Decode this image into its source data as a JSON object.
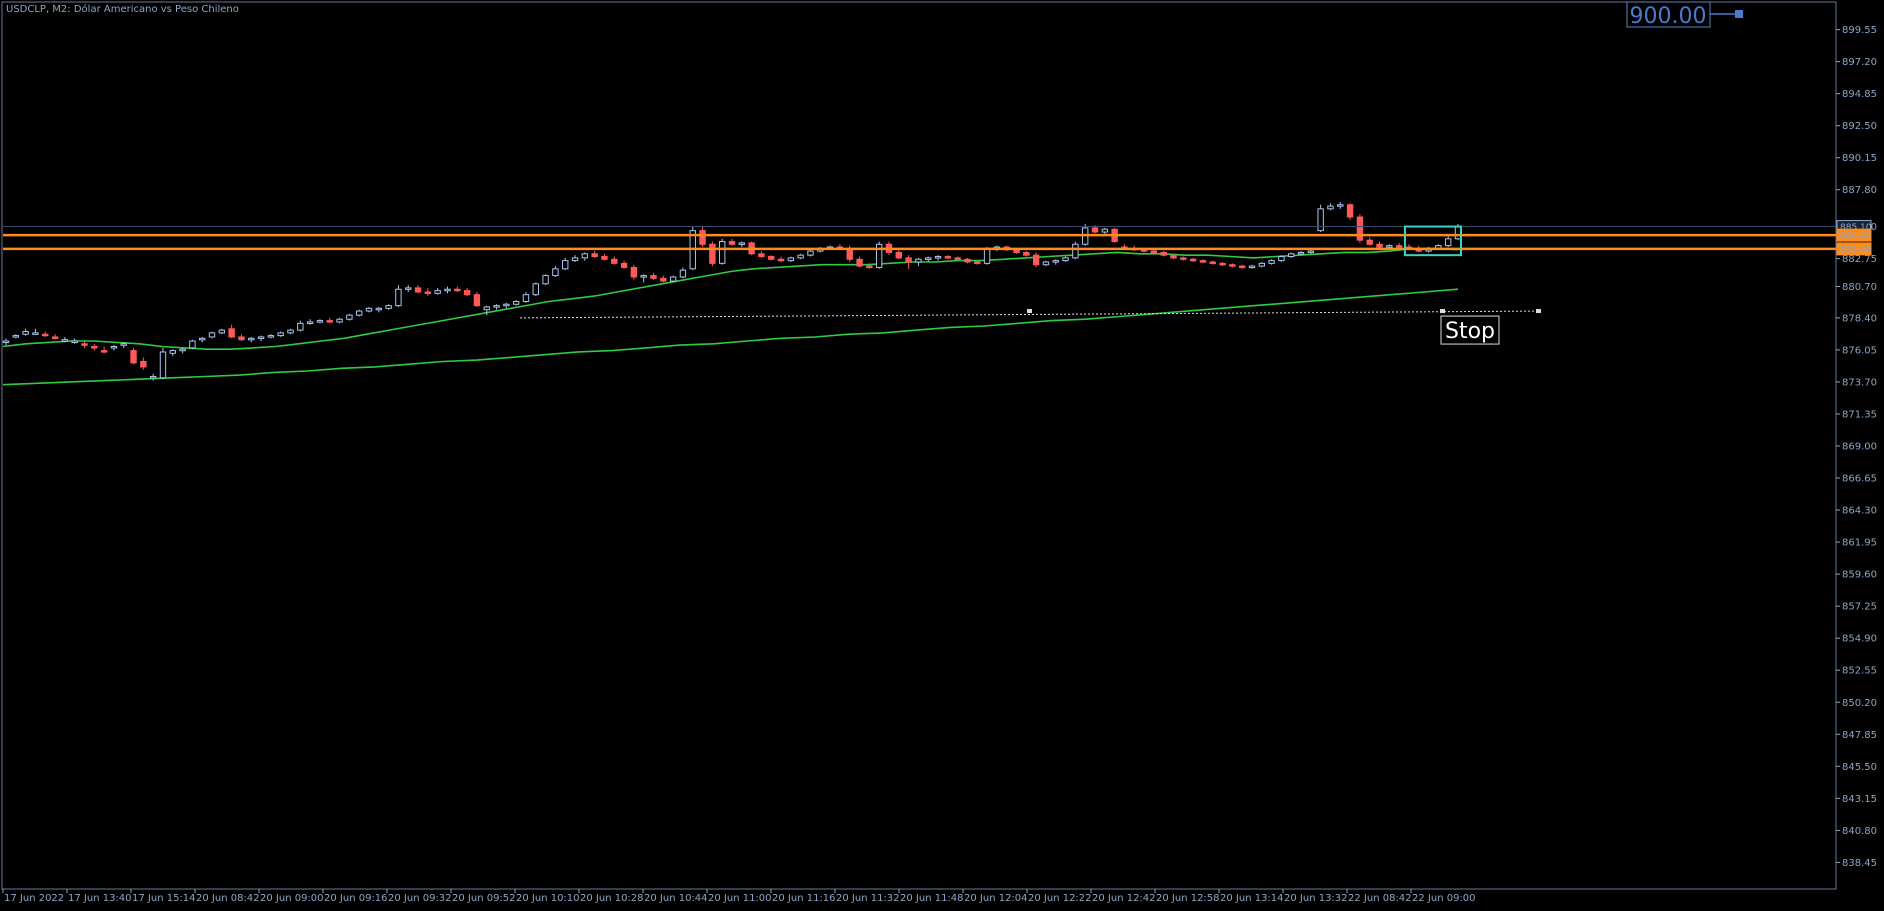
{
  "chart_data": {
    "type": "candlestick",
    "title": "USDCLP, M2:  Dólar Americano vs Peso Chileno",
    "symbol": "USDCLP",
    "timeframe": "M2",
    "description": "Dólar Americano vs Peso Chileno",
    "ylim": [
      836.5,
      901.5
    ],
    "y_ticks": [
      "899.55",
      "897.20",
      "894.85",
      "892.50",
      "890.15",
      "887.80",
      "885.10",
      "882.75",
      "880.70",
      "878.40",
      "876.05",
      "873.70",
      "871.35",
      "869.00",
      "866.65",
      "864.30",
      "861.95",
      "859.60",
      "857.25",
      "854.90",
      "852.55",
      "850.20",
      "847.85",
      "845.50",
      "843.15",
      "840.80",
      "838.45"
    ],
    "x_ticks": [
      "17 Jun 2022",
      "17 Jun 13:40",
      "17 Jun 15:14",
      "20 Jun 08:42",
      "20 Jun 09:00",
      "20 Jun 09:16",
      "20 Jun 09:32",
      "20 Jun 09:52",
      "20 Jun 10:10",
      "20 Jun 10:28",
      "20 Jun 10:44",
      "20 Jun 11:00",
      "20 Jun 11:16",
      "20 Jun 11:32",
      "20 Jun 11:48",
      "20 Jun 12:04",
      "20 Jun 12:22",
      "20 Jun 12:42",
      "20 Jun 12:58",
      "20 Jun 13:14",
      "20 Jun 13:32",
      "22 Jun 08:42",
      "22 Jun 09:00"
    ],
    "candles": [
      {
        "o": 876.6,
        "h": 876.9,
        "l": 876.4,
        "c": 876.7
      },
      {
        "o": 877.0,
        "h": 877.2,
        "l": 876.9,
        "c": 877.1
      },
      {
        "o": 877.2,
        "h": 877.6,
        "l": 877.1,
        "c": 877.4
      },
      {
        "o": 877.3,
        "h": 877.6,
        "l": 877.2,
        "c": 877.3
      },
      {
        "o": 877.2,
        "h": 877.4,
        "l": 877.0,
        "c": 877.1
      },
      {
        "o": 877.0,
        "h": 877.2,
        "l": 876.8,
        "c": 876.9
      },
      {
        "o": 876.8,
        "h": 877.0,
        "l": 876.6,
        "c": 876.8
      },
      {
        "o": 876.7,
        "h": 876.9,
        "l": 876.5,
        "c": 876.7
      },
      {
        "o": 876.5,
        "h": 876.7,
        "l": 876.2,
        "c": 876.4
      },
      {
        "o": 876.3,
        "h": 876.5,
        "l": 876.0,
        "c": 876.2
      },
      {
        "o": 876.0,
        "h": 876.3,
        "l": 875.8,
        "c": 875.9
      },
      {
        "o": 876.2,
        "h": 876.4,
        "l": 876.0,
        "c": 876.3
      },
      {
        "o": 876.4,
        "h": 876.6,
        "l": 876.2,
        "c": 876.5
      },
      {
        "o": 876.0,
        "h": 876.2,
        "l": 875.0,
        "c": 875.1
      },
      {
        "o": 875.2,
        "h": 875.5,
        "l": 874.6,
        "c": 874.8
      },
      {
        "o": 874.0,
        "h": 874.3,
        "l": 873.8,
        "c": 874.1
      },
      {
        "o": 874.0,
        "h": 876.2,
        "l": 873.9,
        "c": 875.9
      },
      {
        "o": 875.8,
        "h": 876.1,
        "l": 875.6,
        "c": 876.0
      },
      {
        "o": 876.0,
        "h": 876.2,
        "l": 875.8,
        "c": 876.1
      },
      {
        "o": 876.2,
        "h": 876.8,
        "l": 876.1,
        "c": 876.7
      },
      {
        "o": 876.8,
        "h": 877.0,
        "l": 876.6,
        "c": 876.9
      },
      {
        "o": 877.0,
        "h": 877.4,
        "l": 876.9,
        "c": 877.3
      },
      {
        "o": 877.3,
        "h": 877.6,
        "l": 877.2,
        "c": 877.5
      },
      {
        "o": 877.6,
        "h": 877.9,
        "l": 876.9,
        "c": 877.0
      },
      {
        "o": 877.0,
        "h": 877.2,
        "l": 876.7,
        "c": 876.8
      },
      {
        "o": 876.8,
        "h": 877.0,
        "l": 876.6,
        "c": 876.9
      },
      {
        "o": 876.9,
        "h": 877.1,
        "l": 876.7,
        "c": 877.0
      },
      {
        "o": 877.0,
        "h": 877.2,
        "l": 876.9,
        "c": 877.1
      },
      {
        "o": 877.1,
        "h": 877.4,
        "l": 877.0,
        "c": 877.3
      },
      {
        "o": 877.3,
        "h": 877.6,
        "l": 877.2,
        "c": 877.5
      },
      {
        "o": 877.5,
        "h": 878.2,
        "l": 877.4,
        "c": 878.0
      },
      {
        "o": 878.0,
        "h": 878.3,
        "l": 877.9,
        "c": 878.1
      },
      {
        "o": 878.1,
        "h": 878.3,
        "l": 878.0,
        "c": 878.2
      },
      {
        "o": 878.2,
        "h": 878.4,
        "l": 878.0,
        "c": 878.1
      },
      {
        "o": 878.1,
        "h": 878.4,
        "l": 878.0,
        "c": 878.3
      },
      {
        "o": 878.3,
        "h": 878.7,
        "l": 878.2,
        "c": 878.6
      },
      {
        "o": 878.6,
        "h": 879.0,
        "l": 878.5,
        "c": 878.9
      },
      {
        "o": 878.9,
        "h": 879.2,
        "l": 878.8,
        "c": 879.1
      },
      {
        "o": 879.0,
        "h": 879.2,
        "l": 878.8,
        "c": 879.1
      },
      {
        "o": 879.1,
        "h": 879.4,
        "l": 879.0,
        "c": 879.3
      },
      {
        "o": 879.3,
        "h": 880.8,
        "l": 879.2,
        "c": 880.5
      },
      {
        "o": 880.5,
        "h": 880.8,
        "l": 880.3,
        "c": 880.6
      },
      {
        "o": 880.6,
        "h": 880.8,
        "l": 880.2,
        "c": 880.3
      },
      {
        "o": 880.3,
        "h": 880.6,
        "l": 880.0,
        "c": 880.2
      },
      {
        "o": 880.2,
        "h": 880.6,
        "l": 880.1,
        "c": 880.4
      },
      {
        "o": 880.4,
        "h": 880.7,
        "l": 880.2,
        "c": 880.5
      },
      {
        "o": 880.5,
        "h": 880.7,
        "l": 880.3,
        "c": 880.4
      },
      {
        "o": 880.4,
        "h": 880.6,
        "l": 880.0,
        "c": 880.1
      },
      {
        "o": 880.1,
        "h": 880.3,
        "l": 879.2,
        "c": 879.3
      },
      {
        "o": 879.0,
        "h": 879.3,
        "l": 878.6,
        "c": 879.2
      },
      {
        "o": 879.2,
        "h": 879.4,
        "l": 879.0,
        "c": 879.3
      },
      {
        "o": 879.3,
        "h": 879.5,
        "l": 879.1,
        "c": 879.4
      },
      {
        "o": 879.4,
        "h": 879.7,
        "l": 879.3,
        "c": 879.6
      },
      {
        "o": 879.6,
        "h": 880.3,
        "l": 879.5,
        "c": 880.1
      },
      {
        "o": 880.1,
        "h": 881.0,
        "l": 880.0,
        "c": 880.9
      },
      {
        "o": 880.9,
        "h": 881.6,
        "l": 880.8,
        "c": 881.5
      },
      {
        "o": 881.5,
        "h": 882.2,
        "l": 881.4,
        "c": 882.0
      },
      {
        "o": 882.0,
        "h": 882.8,
        "l": 881.9,
        "c": 882.6
      },
      {
        "o": 882.6,
        "h": 883.0,
        "l": 882.5,
        "c": 882.8
      },
      {
        "o": 882.8,
        "h": 883.2,
        "l": 882.6,
        "c": 883.1
      },
      {
        "o": 883.1,
        "h": 883.3,
        "l": 882.8,
        "c": 882.9
      },
      {
        "o": 882.9,
        "h": 883.1,
        "l": 882.6,
        "c": 882.7
      },
      {
        "o": 882.7,
        "h": 882.9,
        "l": 882.3,
        "c": 882.4
      },
      {
        "o": 882.4,
        "h": 882.6,
        "l": 882.0,
        "c": 882.1
      },
      {
        "o": 882.1,
        "h": 882.3,
        "l": 881.2,
        "c": 881.4
      },
      {
        "o": 881.4,
        "h": 881.6,
        "l": 881.0,
        "c": 881.5
      },
      {
        "o": 881.5,
        "h": 881.7,
        "l": 881.2,
        "c": 881.3
      },
      {
        "o": 881.3,
        "h": 881.5,
        "l": 881.0,
        "c": 881.1
      },
      {
        "o": 881.1,
        "h": 881.5,
        "l": 881.0,
        "c": 881.4
      },
      {
        "o": 881.4,
        "h": 882.1,
        "l": 881.3,
        "c": 881.9
      },
      {
        "o": 882.0,
        "h": 885.1,
        "l": 881.9,
        "c": 884.8
      },
      {
        "o": 884.8,
        "h": 885.1,
        "l": 883.6,
        "c": 883.8
      },
      {
        "o": 883.8,
        "h": 884.0,
        "l": 882.2,
        "c": 882.4
      },
      {
        "o": 882.4,
        "h": 884.2,
        "l": 882.3,
        "c": 884.0
      },
      {
        "o": 884.0,
        "h": 884.2,
        "l": 883.7,
        "c": 883.8
      },
      {
        "o": 883.8,
        "h": 884.0,
        "l": 883.6,
        "c": 883.9
      },
      {
        "o": 883.9,
        "h": 884.0,
        "l": 883.0,
        "c": 883.1
      },
      {
        "o": 883.1,
        "h": 883.3,
        "l": 882.8,
        "c": 882.9
      },
      {
        "o": 882.9,
        "h": 883.0,
        "l": 882.6,
        "c": 882.7
      },
      {
        "o": 882.7,
        "h": 882.9,
        "l": 882.5,
        "c": 882.6
      },
      {
        "o": 882.6,
        "h": 882.9,
        "l": 882.5,
        "c": 882.8
      },
      {
        "o": 882.8,
        "h": 883.1,
        "l": 882.7,
        "c": 883.0
      },
      {
        "o": 883.0,
        "h": 883.4,
        "l": 882.9,
        "c": 883.3
      },
      {
        "o": 883.3,
        "h": 883.6,
        "l": 883.2,
        "c": 883.5
      },
      {
        "o": 883.5,
        "h": 883.7,
        "l": 883.4,
        "c": 883.6
      },
      {
        "o": 883.6,
        "h": 883.8,
        "l": 883.4,
        "c": 883.5
      },
      {
        "o": 883.5,
        "h": 883.7,
        "l": 882.5,
        "c": 882.7
      },
      {
        "o": 882.7,
        "h": 882.9,
        "l": 882.1,
        "c": 882.2
      },
      {
        "o": 882.2,
        "h": 882.4,
        "l": 882.0,
        "c": 882.1
      },
      {
        "o": 882.1,
        "h": 884.0,
        "l": 882.0,
        "c": 883.8
      },
      {
        "o": 883.8,
        "h": 884.0,
        "l": 883.0,
        "c": 883.2
      },
      {
        "o": 883.2,
        "h": 883.4,
        "l": 882.7,
        "c": 882.8
      },
      {
        "o": 882.8,
        "h": 883.0,
        "l": 882.0,
        "c": 882.5
      },
      {
        "o": 882.5,
        "h": 882.8,
        "l": 882.2,
        "c": 882.7
      },
      {
        "o": 882.7,
        "h": 882.9,
        "l": 882.5,
        "c": 882.8
      },
      {
        "o": 882.8,
        "h": 883.0,
        "l": 882.6,
        "c": 882.9
      },
      {
        "o": 882.9,
        "h": 883.0,
        "l": 882.7,
        "c": 882.8
      },
      {
        "o": 882.8,
        "h": 882.9,
        "l": 882.6,
        "c": 882.7
      },
      {
        "o": 882.7,
        "h": 882.8,
        "l": 882.4,
        "c": 882.5
      },
      {
        "o": 882.5,
        "h": 882.6,
        "l": 882.3,
        "c": 882.4
      },
      {
        "o": 882.4,
        "h": 883.6,
        "l": 882.3,
        "c": 883.5
      },
      {
        "o": 883.5,
        "h": 883.7,
        "l": 883.3,
        "c": 883.6
      },
      {
        "o": 883.6,
        "h": 883.7,
        "l": 883.3,
        "c": 883.4
      },
      {
        "o": 883.4,
        "h": 883.5,
        "l": 883.1,
        "c": 883.2
      },
      {
        "o": 883.2,
        "h": 883.3,
        "l": 882.9,
        "c": 883.0
      },
      {
        "o": 883.0,
        "h": 883.2,
        "l": 882.1,
        "c": 882.3
      },
      {
        "o": 882.3,
        "h": 882.6,
        "l": 882.2,
        "c": 882.5
      },
      {
        "o": 882.5,
        "h": 882.7,
        "l": 882.3,
        "c": 882.6
      },
      {
        "o": 882.6,
        "h": 882.9,
        "l": 882.5,
        "c": 882.8
      },
      {
        "o": 882.8,
        "h": 884.0,
        "l": 882.7,
        "c": 883.8
      },
      {
        "o": 883.8,
        "h": 885.3,
        "l": 883.7,
        "c": 885.0
      },
      {
        "o": 885.0,
        "h": 885.2,
        "l": 884.6,
        "c": 884.7
      },
      {
        "o": 884.7,
        "h": 885.0,
        "l": 884.5,
        "c": 884.9
      },
      {
        "o": 884.9,
        "h": 885.0,
        "l": 883.9,
        "c": 884.0
      },
      {
        "o": 883.6,
        "h": 883.8,
        "l": 883.4,
        "c": 883.5
      },
      {
        "o": 883.5,
        "h": 883.7,
        "l": 883.3,
        "c": 883.4
      },
      {
        "o": 883.4,
        "h": 883.5,
        "l": 883.2,
        "c": 883.3
      },
      {
        "o": 883.3,
        "h": 883.4,
        "l": 883.1,
        "c": 883.2
      },
      {
        "o": 883.2,
        "h": 883.3,
        "l": 882.9,
        "c": 883.0
      },
      {
        "o": 883.0,
        "h": 883.1,
        "l": 882.7,
        "c": 882.8
      },
      {
        "o": 882.8,
        "h": 882.9,
        "l": 882.6,
        "c": 882.7
      },
      {
        "o": 882.7,
        "h": 882.8,
        "l": 882.5,
        "c": 882.6
      },
      {
        "o": 882.6,
        "h": 882.7,
        "l": 882.4,
        "c": 882.5
      },
      {
        "o": 882.5,
        "h": 882.6,
        "l": 882.3,
        "c": 882.4
      },
      {
        "o": 882.4,
        "h": 882.5,
        "l": 882.2,
        "c": 882.3
      },
      {
        "o": 882.3,
        "h": 882.4,
        "l": 882.1,
        "c": 882.2
      },
      {
        "o": 882.2,
        "h": 882.3,
        "l": 882.0,
        "c": 882.1
      },
      {
        "o": 882.1,
        "h": 882.3,
        "l": 882.0,
        "c": 882.2
      },
      {
        "o": 882.2,
        "h": 882.5,
        "l": 882.1,
        "c": 882.4
      },
      {
        "o": 882.4,
        "h": 882.7,
        "l": 882.3,
        "c": 882.6
      },
      {
        "o": 882.6,
        "h": 883.0,
        "l": 882.5,
        "c": 882.9
      },
      {
        "o": 882.9,
        "h": 883.2,
        "l": 882.8,
        "c": 883.1
      },
      {
        "o": 883.1,
        "h": 883.3,
        "l": 883.0,
        "c": 883.2
      },
      {
        "o": 883.2,
        "h": 883.4,
        "l": 883.1,
        "c": 883.3
      },
      {
        "o": 884.8,
        "h": 886.7,
        "l": 884.7,
        "c": 886.4
      },
      {
        "o": 886.4,
        "h": 886.8,
        "l": 886.3,
        "c": 886.6
      },
      {
        "o": 886.6,
        "h": 886.9,
        "l": 886.4,
        "c": 886.7
      },
      {
        "o": 886.7,
        "h": 886.8,
        "l": 885.6,
        "c": 885.8
      },
      {
        "o": 885.8,
        "h": 886.0,
        "l": 883.9,
        "c": 884.1
      },
      {
        "o": 884.1,
        "h": 884.3,
        "l": 883.7,
        "c": 883.8
      },
      {
        "o": 883.8,
        "h": 884.0,
        "l": 883.5,
        "c": 883.6
      },
      {
        "o": 883.6,
        "h": 883.8,
        "l": 883.4,
        "c": 883.7
      },
      {
        "o": 883.7,
        "h": 883.9,
        "l": 883.5,
        "c": 883.6
      },
      {
        "o": 883.6,
        "h": 883.8,
        "l": 883.4,
        "c": 883.5
      },
      {
        "o": 883.5,
        "h": 883.7,
        "l": 883.2,
        "c": 883.3
      },
      {
        "o": 883.3,
        "h": 883.6,
        "l": 883.2,
        "c": 883.5
      },
      {
        "o": 883.5,
        "h": 883.8,
        "l": 883.4,
        "c": 883.7
      },
      {
        "o": 883.7,
        "h": 884.4,
        "l": 883.6,
        "c": 884.2
      },
      {
        "o": 884.2,
        "h": 885.3,
        "l": 884.1,
        "c": 885.1
      }
    ],
    "ma_fast": [
      876.3,
      876.5,
      876.6,
      876.7,
      876.7,
      876.6,
      876.5,
      876.3,
      876.2,
      876.1,
      876.1,
      876.2,
      876.3,
      876.5,
      876.7,
      876.9,
      877.2,
      877.5,
      877.8,
      878.1,
      878.4,
      878.7,
      879.0,
      879.3,
      879.6,
      879.8,
      880.0,
      880.3,
      880.6,
      880.9,
      881.2,
      881.5,
      881.8,
      882.0,
      882.1,
      882.2,
      882.3,
      882.3,
      882.3,
      882.4,
      882.5,
      882.5,
      882.6,
      882.6,
      882.7,
      882.8,
      882.9,
      883.0,
      883.1,
      883.2,
      883.1,
      883.1,
      883.0,
      883.0,
      882.9,
      882.8,
      882.9,
      883.0,
      883.1,
      883.2,
      883.2,
      883.3,
      883.5,
      883.5,
      883.4
    ],
    "ma_slow": [
      873.5,
      873.6,
      873.7,
      873.8,
      873.9,
      874.0,
      874.1,
      874.2,
      874.4,
      874.5,
      874.7,
      874.8,
      875.0,
      875.2,
      875.3,
      875.5,
      875.7,
      875.9,
      876.0,
      876.2,
      876.4,
      876.5,
      876.7,
      876.9,
      877.0,
      877.2,
      877.3,
      877.5,
      877.7,
      877.8,
      878.0,
      878.2,
      878.3,
      878.5,
      878.7,
      878.9,
      879.1,
      879.3,
      879.5,
      879.7,
      879.9,
      880.1,
      880.3,
      880.5
    ],
    "levels": [
      {
        "price": 885.1,
        "label": "885.10",
        "color": "#3a4a6a"
      },
      {
        "price": 884.47,
        "label": "884.47",
        "color": "#ff8c1a"
      },
      {
        "price": 883.46,
        "label": "883.46",
        "color": "#ff8c1a"
      }
    ],
    "annotations": {
      "big_price": "900.00",
      "stop_text": "Stop",
      "stop_price": 878.9
    },
    "colors": {
      "bull": "#a8c4f0",
      "bear": "#ff5a5a",
      "ma_fast": "#2ecc40",
      "ma_slow": "#2ecc40",
      "level": "#ff8c1a",
      "box": "#39d4c4",
      "axis": "#8aa6c8",
      "border": "#6a7a9a"
    }
  }
}
